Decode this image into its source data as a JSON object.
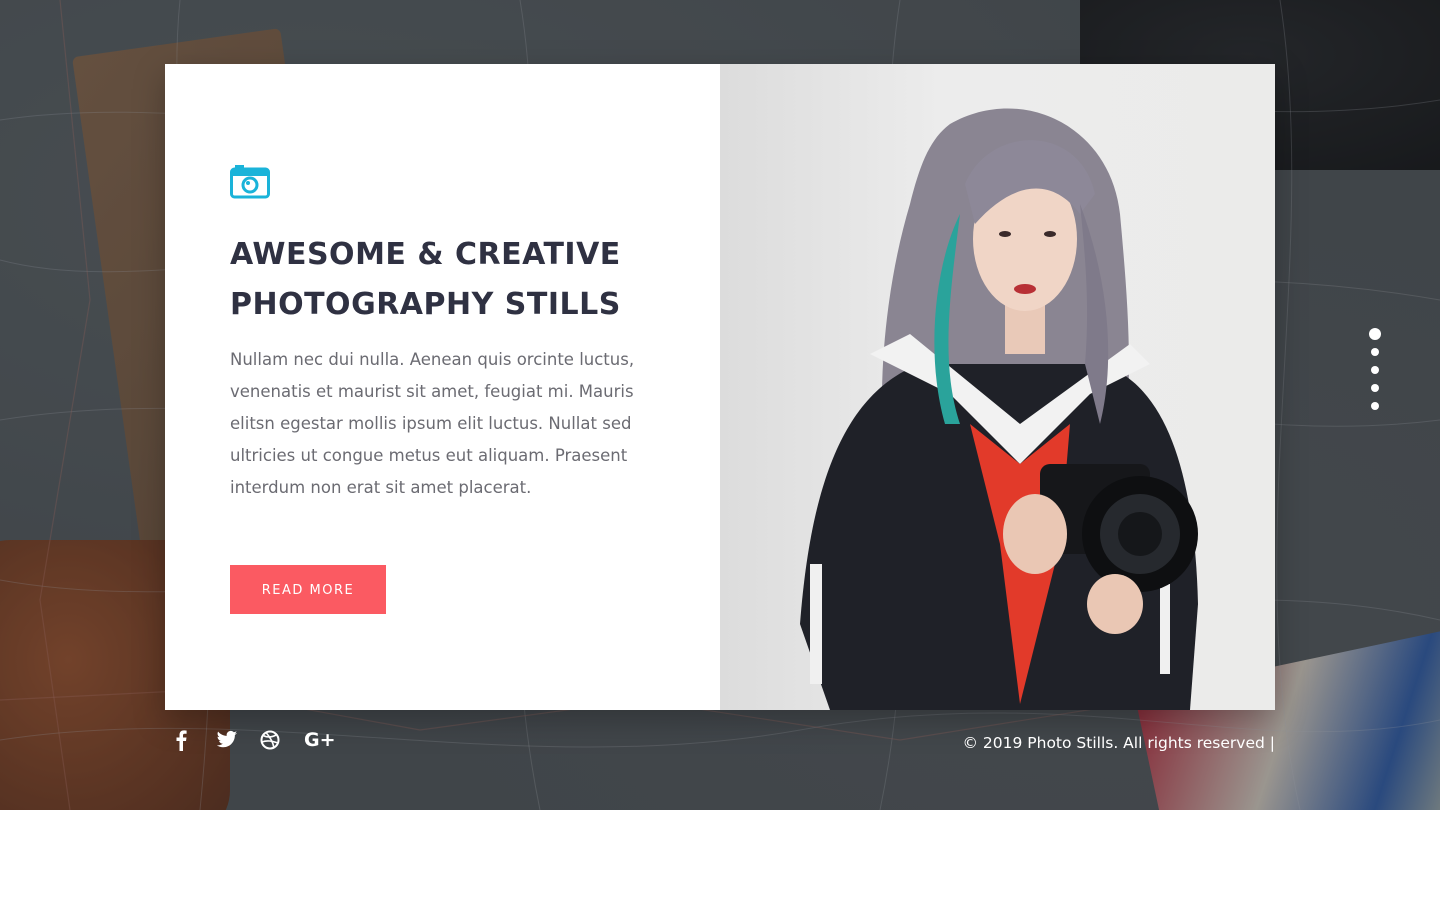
{
  "hero": {
    "icon": "camera-icon",
    "headline": "AWESOME & CREATIVE PHOTOGRAPHY STILLS",
    "body": "Nullam nec dui nulla. Aenean quis orcinte luctus, venenatis et maurist sit amet, feugiat mi. Mauris elitsn egestar mollis ipsum elit luctus. Nullat sed ultricies ut congue metus eut aliquam. Praesent interdum non erat sit amet placerat.",
    "button_label": "READ MORE",
    "photo": "woman-with-camera-photo"
  },
  "slider": {
    "dot_count": 5,
    "active_index": 0
  },
  "footer": {
    "socials": [
      "facebook-icon",
      "twitter-icon",
      "dribbble-icon",
      "google-plus-icon"
    ],
    "google_plus_label": "G+",
    "copyright": "© 2019 Photo Stills. All rights reserved |"
  },
  "colors": {
    "accent": "#fb5a62",
    "icon_blue": "#1ab3d9",
    "heading": "#2f3142",
    "text": "#6b6b72"
  }
}
